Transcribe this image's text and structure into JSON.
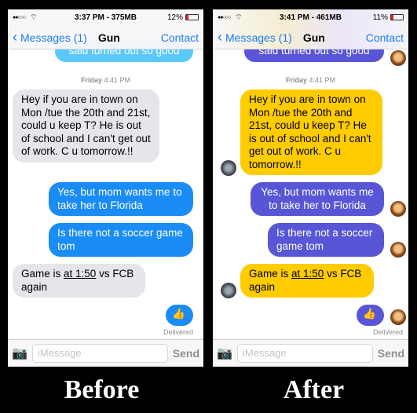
{
  "before": {
    "caption": "Before",
    "status": {
      "signal": "●●○○○",
      "carrier_icon": "wifi-icon",
      "time": "3:37 PM - 375MB",
      "battery": "12%"
    },
    "nav": {
      "back": "Messages (1)",
      "title": "Gun",
      "action": "Contact"
    },
    "colors": {
      "incoming": "#e5e5ea",
      "outgoing": "#1a8cf5"
    }
  },
  "after": {
    "caption": "After",
    "status": {
      "signal": "●●○○○",
      "carrier_icon": "wifi-icon",
      "time": "3:41 PM - 461MB",
      "battery": "11%"
    },
    "nav": {
      "back": "Messages (1)",
      "title": "Gun",
      "action": "Contact"
    },
    "colors": {
      "incoming": "#ffcc00",
      "outgoing": "#5856d6"
    }
  },
  "conversation": {
    "partial": "said turned out so good",
    "stamp_day": "Friday",
    "stamp_time": "4:41 PM",
    "msg1": "Hey if you are in town on Mon /tue the 20th and 21st, could u keep T? He is out of school and I can't get out of work. C u tomorrow.!!",
    "msg2": "Yes, but mom wants me to take her to Florida",
    "msg3": "Is there not a soccer game tom",
    "msg4_pre": "Game is ",
    "msg4_link": "at 1:50",
    "msg4_post": " vs FCB again",
    "msg5": "👍",
    "delivered": "Delivered"
  },
  "input": {
    "placeholder": "iMessage",
    "send": "Send",
    "camera_icon": "camera-icon"
  }
}
